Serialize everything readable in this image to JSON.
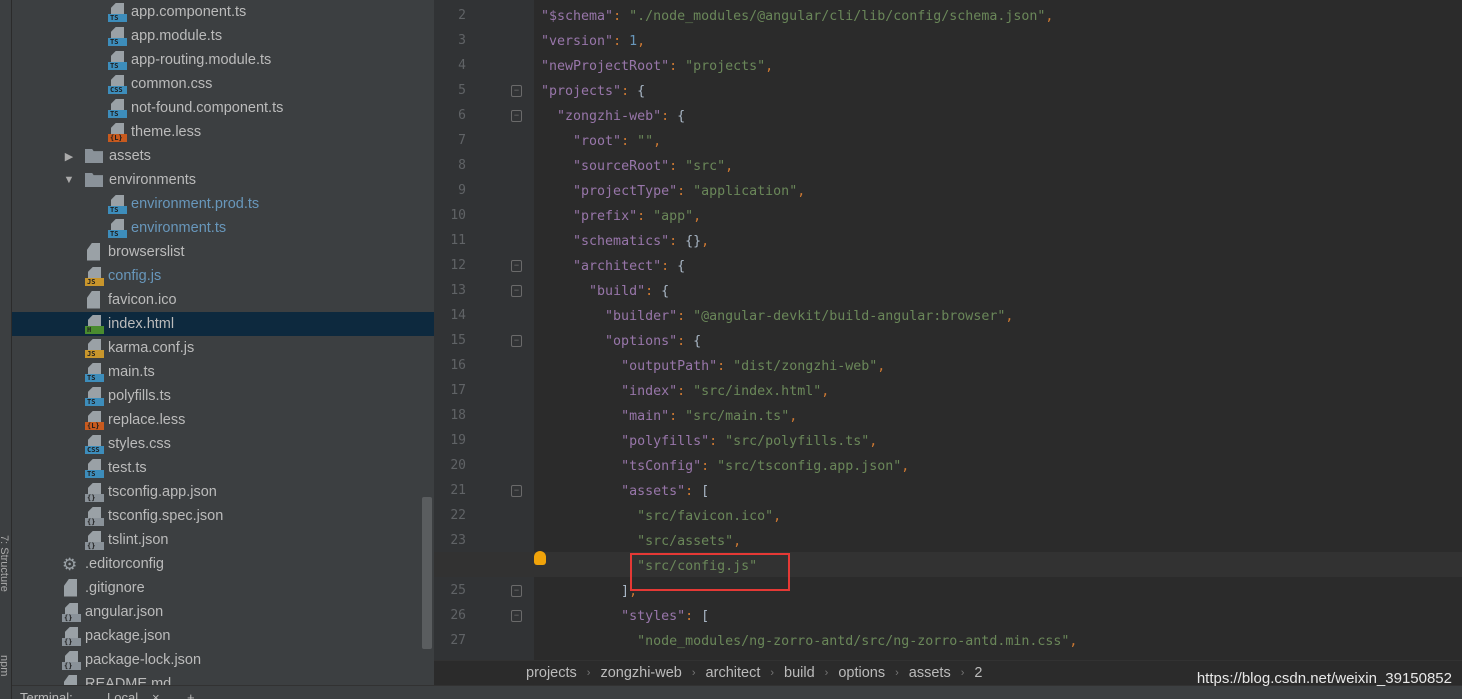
{
  "side_strip": {
    "labels": [
      "7: Structure",
      "npm"
    ]
  },
  "tree": [
    {
      "name": "app.component.ts",
      "level": 3,
      "icon": "ts-file-icon",
      "badge": "TS",
      "color": "#3d8dbb"
    },
    {
      "name": "app.module.ts",
      "level": 3,
      "icon": "ts-file-icon",
      "badge": "TS",
      "color": "#3d8dbb"
    },
    {
      "name": "app-routing.module.ts",
      "level": 3,
      "icon": "ts-file-icon",
      "badge": "TS",
      "color": "#3d8dbb"
    },
    {
      "name": "common.css",
      "level": 3,
      "icon": "css-file-icon",
      "badge": "CSS",
      "color": "#3d8dbb"
    },
    {
      "name": "not-found.component.ts",
      "level": 3,
      "icon": "ts-file-icon",
      "badge": "TS",
      "color": "#3d8dbb"
    },
    {
      "name": "theme.less",
      "level": 3,
      "icon": "less-file-icon",
      "badge": "{L}",
      "color": "#c85a1e"
    },
    {
      "name": "assets",
      "level": 2,
      "icon": "folder-icon",
      "folder": "collapsed"
    },
    {
      "name": "environments",
      "level": 2,
      "icon": "folder-icon",
      "folder": "expanded"
    },
    {
      "name": "environment.prod.ts",
      "level": 3,
      "icon": "ts-file-icon",
      "badge": "TS",
      "color": "#3d8dbb",
      "modified": true
    },
    {
      "name": "environment.ts",
      "level": 3,
      "icon": "ts-file-icon",
      "badge": "TS",
      "color": "#3d8dbb",
      "modified": true
    },
    {
      "name": "browserslist",
      "level": 2,
      "icon": "text-file-icon"
    },
    {
      "name": "config.js",
      "level": 2,
      "icon": "js-file-icon",
      "badge": "JS",
      "color": "#c9962c",
      "modified": true
    },
    {
      "name": "favicon.ico",
      "level": 2,
      "icon": "image-file-icon"
    },
    {
      "name": "index.html",
      "level": 2,
      "icon": "html-file-icon",
      "badge": "H",
      "color": "#4a8c2f",
      "selected": true
    },
    {
      "name": "karma.conf.js",
      "level": 2,
      "icon": "js-file-icon",
      "badge": "JS",
      "color": "#c9962c"
    },
    {
      "name": "main.ts",
      "level": 2,
      "icon": "ts-file-icon",
      "badge": "TS",
      "color": "#3d8dbb"
    },
    {
      "name": "polyfills.ts",
      "level": 2,
      "icon": "ts-file-icon",
      "badge": "TS",
      "color": "#3d8dbb"
    },
    {
      "name": "replace.less",
      "level": 2,
      "icon": "less-file-icon",
      "badge": "{L}",
      "color": "#c85a1e"
    },
    {
      "name": "styles.css",
      "level": 2,
      "icon": "css-file-icon",
      "badge": "CSS",
      "color": "#3d8dbb"
    },
    {
      "name": "test.ts",
      "level": 2,
      "icon": "ts-file-icon",
      "badge": "TS",
      "color": "#3d8dbb"
    },
    {
      "name": "tsconfig.app.json",
      "level": 2,
      "icon": "json-file-icon",
      "badge": "{}",
      "color": "#8a9299"
    },
    {
      "name": "tsconfig.spec.json",
      "level": 2,
      "icon": "json-file-icon",
      "badge": "{}",
      "color": "#8a9299"
    },
    {
      "name": "tslint.json",
      "level": 2,
      "icon": "json-file-icon",
      "badge": "{}",
      "color": "#8a9299"
    },
    {
      "name": ".editorconfig",
      "level": 1,
      "icon": "gear-icon"
    },
    {
      "name": ".gitignore",
      "level": 1,
      "icon": "text-file-icon"
    },
    {
      "name": "angular.json",
      "level": 1,
      "icon": "json-file-icon",
      "badge": "{}",
      "color": "#8a9299"
    },
    {
      "name": "package.json",
      "level": 1,
      "icon": "json-file-icon",
      "badge": "{}",
      "color": "#8a9299"
    },
    {
      "name": "package-lock.json",
      "level": 1,
      "icon": "json-file-icon",
      "badge": "{}",
      "color": "#8a9299"
    },
    {
      "name": "README.md",
      "level": 1,
      "icon": "text-file-icon"
    }
  ],
  "editor": {
    "current_line": 24,
    "lines": [
      {
        "n": 2,
        "t": [
          [
            " ",
            ""
          ],
          [
            "k",
            "\"$schema\""
          ],
          [
            "p",
            ": "
          ],
          [
            "s",
            "\"./node_modules/@angular/cli/lib/config/schema.json\""
          ],
          [
            "p",
            ","
          ]
        ]
      },
      {
        "n": 3,
        "t": [
          [
            " ",
            ""
          ],
          [
            "k",
            "\"version\""
          ],
          [
            "p",
            ": "
          ],
          [
            "n",
            "1"
          ],
          [
            "p",
            ","
          ]
        ]
      },
      {
        "n": 4,
        "t": [
          [
            " ",
            ""
          ],
          [
            "k",
            "\"newProjectRoot\""
          ],
          [
            "p",
            ": "
          ],
          [
            "s",
            "\"projects\""
          ],
          [
            "p",
            ","
          ]
        ]
      },
      {
        "n": 5,
        "fold": true,
        "t": [
          [
            " ",
            ""
          ],
          [
            "k",
            "\"projects\""
          ],
          [
            "p",
            ": "
          ],
          [
            " ",
            "{"
          ]
        ]
      },
      {
        "n": 6,
        "fold": true,
        "t": [
          [
            " ",
            "  "
          ],
          [
            "k",
            "\"zongzhi-web\""
          ],
          [
            "p",
            ": "
          ],
          [
            " ",
            "{"
          ]
        ]
      },
      {
        "n": 7,
        "t": [
          [
            " ",
            "    "
          ],
          [
            "k",
            "\"root\""
          ],
          [
            "p",
            ": "
          ],
          [
            "s",
            "\"\""
          ],
          [
            "p",
            ","
          ]
        ]
      },
      {
        "n": 8,
        "t": [
          [
            " ",
            "    "
          ],
          [
            "k",
            "\"sourceRoot\""
          ],
          [
            "p",
            ": "
          ],
          [
            "s",
            "\"src\""
          ],
          [
            "p",
            ","
          ]
        ]
      },
      {
        "n": 9,
        "t": [
          [
            " ",
            "    "
          ],
          [
            "k",
            "\"projectType\""
          ],
          [
            "p",
            ": "
          ],
          [
            "s",
            "\"application\""
          ],
          [
            "p",
            ","
          ]
        ]
      },
      {
        "n": 10,
        "t": [
          [
            " ",
            "    "
          ],
          [
            "k",
            "\"prefix\""
          ],
          [
            "p",
            ": "
          ],
          [
            "s",
            "\"app\""
          ],
          [
            "p",
            ","
          ]
        ]
      },
      {
        "n": 11,
        "t": [
          [
            " ",
            "    "
          ],
          [
            "k",
            "\"schematics\""
          ],
          [
            "p",
            ": "
          ],
          [
            " ",
            "{}"
          ],
          [
            "p",
            ","
          ]
        ]
      },
      {
        "n": 12,
        "fold": true,
        "t": [
          [
            " ",
            "    "
          ],
          [
            "k",
            "\"architect\""
          ],
          [
            "p",
            ": "
          ],
          [
            " ",
            "{"
          ]
        ]
      },
      {
        "n": 13,
        "fold": true,
        "t": [
          [
            " ",
            "      "
          ],
          [
            "k",
            "\"build\""
          ],
          [
            "p",
            ": "
          ],
          [
            " ",
            "{"
          ]
        ]
      },
      {
        "n": 14,
        "t": [
          [
            " ",
            "        "
          ],
          [
            "k",
            "\"builder\""
          ],
          [
            "p",
            ": "
          ],
          [
            "s",
            "\"@angular-devkit/build-angular:browser\""
          ],
          [
            "p",
            ","
          ]
        ]
      },
      {
        "n": 15,
        "fold": true,
        "t": [
          [
            " ",
            "        "
          ],
          [
            "k",
            "\"options\""
          ],
          [
            "p",
            ": "
          ],
          [
            " ",
            "{"
          ]
        ]
      },
      {
        "n": 16,
        "t": [
          [
            " ",
            "          "
          ],
          [
            "k",
            "\"outputPath\""
          ],
          [
            "p",
            ": "
          ],
          [
            "s",
            "\"dist/zongzhi-web\""
          ],
          [
            "p",
            ","
          ]
        ]
      },
      {
        "n": 17,
        "t": [
          [
            " ",
            "          "
          ],
          [
            "k",
            "\"index\""
          ],
          [
            "p",
            ": "
          ],
          [
            "s",
            "\"src/index.html\""
          ],
          [
            "p",
            ","
          ]
        ]
      },
      {
        "n": 18,
        "t": [
          [
            " ",
            "          "
          ],
          [
            "k",
            "\"main\""
          ],
          [
            "p",
            ": "
          ],
          [
            "s",
            "\"src/main.ts\""
          ],
          [
            "p",
            ","
          ]
        ]
      },
      {
        "n": 19,
        "t": [
          [
            " ",
            "          "
          ],
          [
            "k",
            "\"polyfills\""
          ],
          [
            "p",
            ": "
          ],
          [
            "s",
            "\"src/polyfills.ts\""
          ],
          [
            "p",
            ","
          ]
        ]
      },
      {
        "n": 20,
        "t": [
          [
            " ",
            "          "
          ],
          [
            "k",
            "\"tsConfig\""
          ],
          [
            "p",
            ": "
          ],
          [
            "s",
            "\"src/tsconfig.app.json\""
          ],
          [
            "p",
            ","
          ]
        ]
      },
      {
        "n": 21,
        "fold": true,
        "t": [
          [
            " ",
            "          "
          ],
          [
            "k",
            "\"assets\""
          ],
          [
            "p",
            ": "
          ],
          [
            " ",
            "["
          ]
        ]
      },
      {
        "n": 22,
        "t": [
          [
            " ",
            "            "
          ],
          [
            "s",
            "\"src/favicon.ico\""
          ],
          [
            "p",
            ","
          ]
        ]
      },
      {
        "n": 23,
        "t": [
          [
            " ",
            "            "
          ],
          [
            "s",
            "\"src/assets\""
          ],
          [
            "p",
            ","
          ]
        ]
      },
      {
        "n": 24,
        "t": [
          [
            " ",
            "            "
          ],
          [
            "s",
            "\"src/config.js\""
          ]
        ]
      },
      {
        "n": 25,
        "fold": true,
        "t": [
          [
            " ",
            "          ]"
          ],
          [
            "p",
            ","
          ]
        ]
      },
      {
        "n": 26,
        "fold": true,
        "t": [
          [
            " ",
            "          "
          ],
          [
            "k",
            "\"styles\""
          ],
          [
            "p",
            ": "
          ],
          [
            " ",
            "["
          ]
        ]
      },
      {
        "n": 27,
        "t": [
          [
            " ",
            "            "
          ],
          [
            "s",
            "\"node_modules/ng-zorro-antd/src/ng-zorro-antd.min.css\""
          ],
          [
            "p",
            ","
          ]
        ]
      }
    ]
  },
  "breadcrumb": [
    "projects",
    "zongzhi-web",
    "architect",
    "build",
    "options",
    "assets",
    "2"
  ],
  "bottom": {
    "terminal_label": "Terminal:",
    "tab_label": "Local",
    "close": "×",
    "add": "+"
  },
  "watermark": "https://blog.csdn.net/weixin_39150852"
}
